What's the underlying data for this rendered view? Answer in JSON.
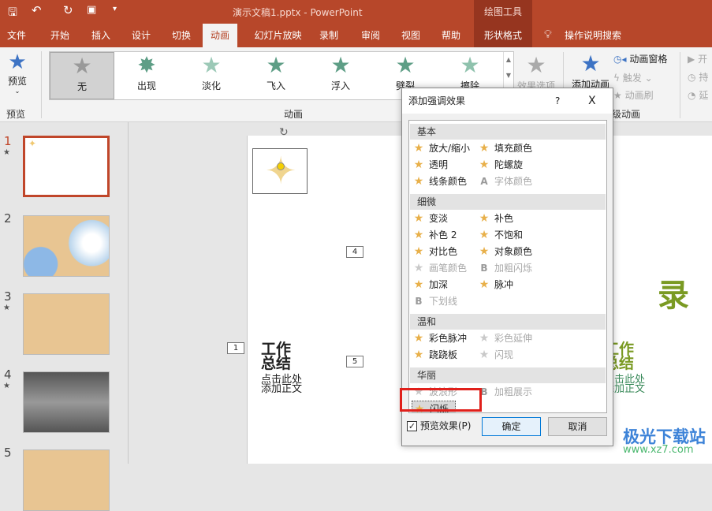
{
  "title": {
    "doc": "演示文稿1.pptx  -  PowerPoint",
    "context": "绘图工具"
  },
  "tabs": [
    "文件",
    "开始",
    "插入",
    "设计",
    "切换",
    "动画",
    "幻灯片放映",
    "录制",
    "审阅",
    "视图",
    "帮助",
    "形状格式"
  ],
  "tell_me": "操作说明搜索",
  "ribbon": {
    "preview": "预览",
    "preview_group": "预览",
    "gallery": [
      "无",
      "出现",
      "淡化",
      "飞入",
      "浮入",
      "劈裂",
      "擦除"
    ],
    "effect_options": "效果选项",
    "anim_group": "动画",
    "add_anim": "添加动画",
    "pane": "动画窗格",
    "trigger": "触发",
    "painter": "动画刷",
    "adv_group": "级动画",
    "start": "开",
    "duration": "持",
    "delay": "延"
  },
  "slides": [
    "1",
    "2",
    "3",
    "4",
    "5"
  ],
  "slide": {
    "tags": [
      "4",
      "1",
      "5"
    ],
    "title": "工作\n总结",
    "sub": "点击此处\n添加正文",
    "title2": "工作\n总结",
    "sub2": "点击此处\n添加正文",
    "char": "录"
  },
  "dialog": {
    "title": "添加强调效果",
    "help": "?",
    "close": "X",
    "groups": [
      {
        "name": "基本",
        "items": [
          {
            "l": "放大/缩小",
            "on": true
          },
          {
            "l": "填充颜色",
            "on": true
          },
          {
            "l": "透明",
            "on": true
          },
          {
            "l": "陀螺旋",
            "on": true
          },
          {
            "l": "线条颜色",
            "on": true
          },
          {
            "l": "字体颜色",
            "on": false,
            "i": "A"
          }
        ]
      },
      {
        "name": "细微",
        "items": [
          {
            "l": "变淡",
            "on": true
          },
          {
            "l": "补色",
            "on": true
          },
          {
            "l": "补色 2",
            "on": true
          },
          {
            "l": "不饱和",
            "on": true
          },
          {
            "l": "对比色",
            "on": true
          },
          {
            "l": "对象颜色",
            "on": true
          },
          {
            "l": "画笔颜色",
            "on": false
          },
          {
            "l": "加粗闪烁",
            "on": false,
            "i": "B"
          },
          {
            "l": "加深",
            "on": true
          },
          {
            "l": "脉冲",
            "on": true
          },
          {
            "l": "下划线",
            "on": false,
            "i": "B"
          }
        ]
      },
      {
        "name": "温和",
        "items": [
          {
            "l": "彩色脉冲",
            "on": true
          },
          {
            "l": "彩色延伸",
            "on": false
          },
          {
            "l": "跷跷板",
            "on": true
          },
          {
            "l": "闪现",
            "on": false
          }
        ]
      },
      {
        "name": "华丽",
        "items": [
          {
            "l": "波浪形",
            "on": false
          },
          {
            "l": "加粗展示",
            "on": false,
            "i": "B"
          },
          {
            "l": "闪烁",
            "on": true,
            "sel": true
          }
        ]
      }
    ],
    "preview": "预览效果(P)",
    "ok": "确定",
    "cancel": "取消"
  },
  "watermark": {
    "name": "极光下载站",
    "url": "www.xz7.com"
  }
}
